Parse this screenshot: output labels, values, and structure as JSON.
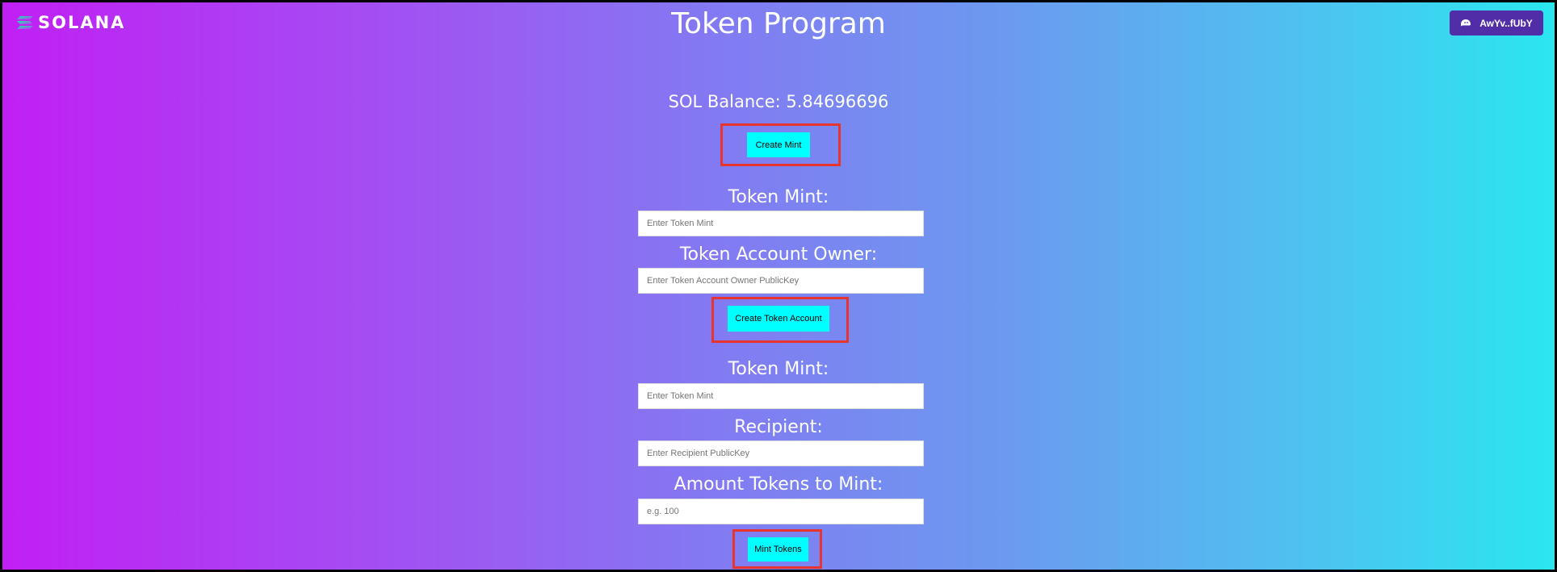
{
  "header": {
    "logo_text": "SOLANA",
    "title": "Token Program",
    "wallet_label": "AwYv..fUbY"
  },
  "balance": {
    "text": "SOL Balance: 5.84696696"
  },
  "create_mint": {
    "button_label": "Create Mint"
  },
  "token_account": {
    "mint_label": "Token Mint:",
    "mint_placeholder": "Enter Token Mint",
    "owner_label": "Token Account Owner:",
    "owner_placeholder": "Enter Token Account Owner PublicKey",
    "button_label": "Create Token Account"
  },
  "mint_tokens": {
    "mint_label": "Token Mint:",
    "mint_placeholder": "Enter Token Mint",
    "recipient_label": "Recipient:",
    "recipient_placeholder": "Enter Recipient PublicKey",
    "amount_label": "Amount Tokens to Mint:",
    "amount_placeholder": "e.g. 100",
    "button_label": "Mint Tokens"
  },
  "colors": {
    "accent_button": "#00ffff",
    "wallet_button": "#512da8",
    "highlight_box": "#e8342f"
  },
  "icons": {
    "logo": "solana-logo-icon",
    "wallet": "phantom-wallet-icon"
  }
}
